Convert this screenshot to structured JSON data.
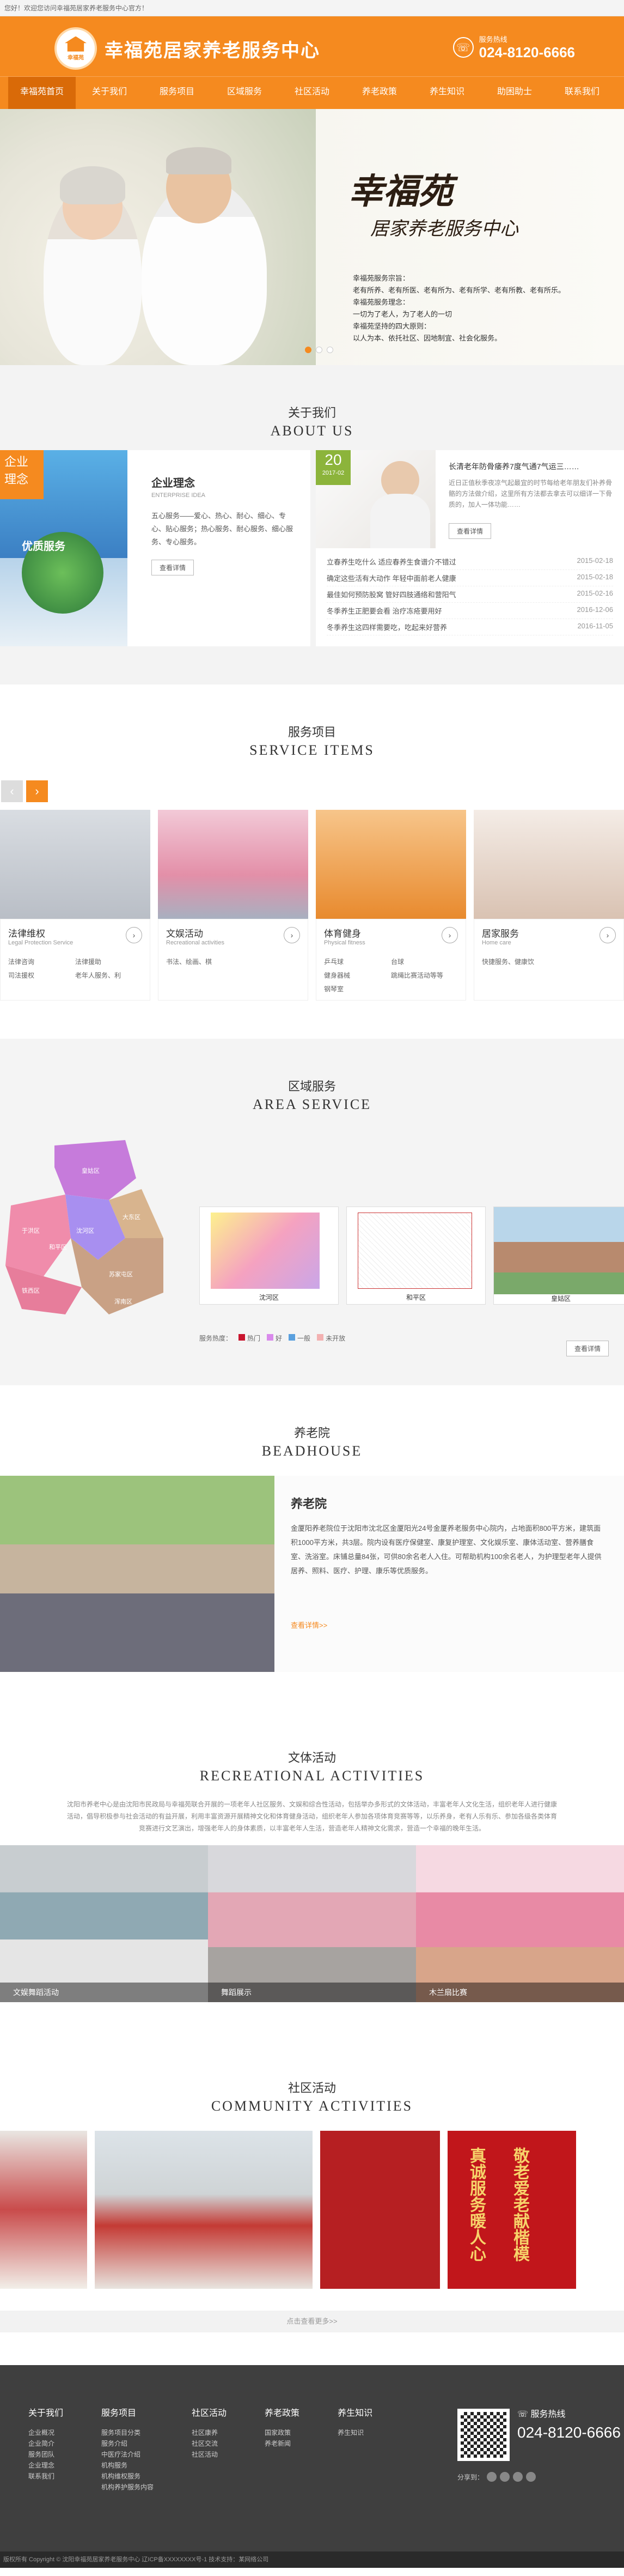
{
  "topbar": {
    "text": "您好！欢迎您访问幸福苑居家养老服务中心官方！"
  },
  "header": {
    "logo_text": "幸福苑",
    "site_title": "幸福苑居家养老服务中心",
    "hotline_label": "服务热线",
    "hotline_number": "024-8120-6666"
  },
  "nav": [
    "幸福苑首页",
    "关于我们",
    "服务项目",
    "区域服务",
    "社区活动",
    "养老政策",
    "养生知识",
    "助困助士",
    "联系我们"
  ],
  "banner": {
    "calligraphy_main": "幸福苑",
    "calligraphy_sub": "居家养老服务中心",
    "lines": [
      "幸福苑服务宗旨：",
      "老有所养、老有所医、老有所为、老有所学、老有所教、老有所乐。",
      "幸福苑服务理念：",
      "一切为了老人，为了老人的一切",
      "幸福苑坚持的四大原则：",
      "以人为本、依托社区、因地制宜、社会化服务。"
    ]
  },
  "about": {
    "title_cn": "关于我们",
    "title_en": "ABOUT US",
    "left_badge_1": "企业",
    "left_badge_2": "理念",
    "left_img_text": "优质服务",
    "left_heading": "企业理念",
    "left_sub": "ENTERPRISE IDEA",
    "left_body": "五心服务——爱心、热心、耐心、细心、专心、贴心服务；热心服务、耐心服务、细心服务、专心服务。",
    "left_more": "查看详情",
    "date_day": "20",
    "date_month": "2017-02",
    "news_title": "长清老年防骨痿养7度气通7气运三……",
    "news_body": "近日正值秋季夜凉气起最宜的时节每给老年朋友们补养骨骼的方法做介绍，这里所有方法都去拿去可以细详一下骨质的，加人一体功能……",
    "news_more": "查看详情",
    "news": [
      {
        "title": "立春养生吃什么 适应春养生食谱介不错过",
        "date": "2015-02-18"
      },
      {
        "title": "确定这些活有大动作 年轻中面前老人健康",
        "date": "2015-02-18"
      },
      {
        "title": "最佳如何预防股窝 管好四肢通络和营阳气",
        "date": "2015-02-16"
      },
      {
        "title": "冬季养生正肥要会看 治疗冻疮要用好",
        "date": "2016-12-06"
      },
      {
        "title": "冬季养生这四样需要吃，吃起来好营养",
        "date": "2016-11-05"
      }
    ]
  },
  "service": {
    "title_cn": "服务项目",
    "title_en": "SERVICE ITEMS",
    "items": [
      {
        "title": "法律维权",
        "en": "Legal Protection Service",
        "tags": [
          "法律咨询",
          "法律援助",
          "司法援权",
          "老年人服务、利"
        ]
      },
      {
        "title": "文娱活动",
        "en": "Recreational activities",
        "tags": [
          "书法、绘画、棋",
          ""
        ]
      },
      {
        "title": "体育健身",
        "en": "Physical fitness",
        "tags": [
          "乒乓球",
          "台球",
          "健身器械",
          "跳绳比赛活动等等",
          "钢琴室",
          ""
        ]
      },
      {
        "title": "居家服务",
        "en": "Home care",
        "tags": [
          "快捷服务、健康饮",
          ""
        ]
      }
    ]
  },
  "area": {
    "title_cn": "区域服务",
    "title_en": "AREA SERVICE",
    "districts": [
      "皇姑区",
      "沈河区",
      "于洪区",
      "大东区",
      "苏家屯区",
      "和平区",
      "浑南区",
      "铁西区"
    ],
    "thumbs": [
      "沈河区",
      "和平区"
    ],
    "third_thumb": "沈河区",
    "legend_label": "服务热度：",
    "legend": [
      {
        "label": "热门",
        "color": "#c9152e"
      },
      {
        "label": "好",
        "color": "#d98aeb"
      },
      {
        "label": "一般",
        "color": "#5aa0de"
      },
      {
        "label": "未开放",
        "color": "#f3b1b1"
      }
    ],
    "more": "查看详情",
    "thumb_captions": [
      "沈河区",
      "和平区",
      "皇姑区"
    ]
  },
  "beadhouse": {
    "title_cn": "养老院",
    "title_en": "BEADHOUSE",
    "heading": "养老院",
    "body": "金厦阳养老院位于沈阳市沈北区金厦阳光24号金厦养老服务中心院内，占地面积800平方米，建筑面积1000平方米，共3层。院内设有医疗保健室、康复护理室、文化娱乐室、康体活动室、营养膳食室、洗浴室。床铺总量84张，可供80余名老人入住。可帮助机构100余名老人，为护理型老年人提供居养、照料、医疗、护理、康乐等优质服务。",
    "more": "查看详情>>"
  },
  "recreation": {
    "title_cn": "文体活动",
    "title_en": "RECREATIONAL ACTIVITIES",
    "desc": "沈阳市养老中心是由沈阳市民政局与幸福苑联合开展的一项老年人社区服务、文娱和综合性活动，包括举办多形式的文体活动，丰富老年人文化生活，组织老年人进行健康活动，倡导积极参与社会活动的有益开展，利用丰富资源开展精神文化和体育健身活动，组织老年人参加各项体育竞赛等等，以乐养身，老有人乐有乐、参加各级各类体育竞赛进行文艺演出，增强老年人的身体素质，以丰富老年人生活，营造老年人精神文化需求，营造一个幸福的晚年生活。",
    "items": [
      "文娱舞蹈活动",
      "舞蹈展示",
      "木兰扇比赛"
    ]
  },
  "community": {
    "title_cn": "社区活动",
    "title_en": "COMMUNITY ACTIVITIES",
    "banner_text_1": "真诚服务暖人心",
    "banner_text_2": "敬老爱老献楷模",
    "more": "点击查看更多>>"
  },
  "footer": {
    "cols": [
      {
        "title": "关于我们",
        "links": [
          "企业概况",
          "企业简介",
          "服务团队",
          "企业理念",
          "联系我们"
        ]
      },
      {
        "title": "服务项目",
        "links": [
          "服务项目分类",
          "服务介绍",
          "中医疗法介绍",
          "机构服务",
          "机构维权服务",
          "机构养护服务内容"
        ]
      },
      {
        "title": "社区活动",
        "links": [
          "社区康养",
          "社区交流",
          "社区活动"
        ]
      },
      {
        "title": "养老政策",
        "links": [
          "国家政策",
          "养老新闻"
        ]
      },
      {
        "title": "养生知识",
        "links": [
          "养生知识"
        ]
      }
    ],
    "hotline_label": "服务热线",
    "hotline_number": "024-8120-6666",
    "share_label": "分享到："
  },
  "copyright": "版权所有 Copyright © 沈阳幸福苑居家养老服务中心 辽ICP备XXXXXXXX号-1 技术支持：某网络公司"
}
